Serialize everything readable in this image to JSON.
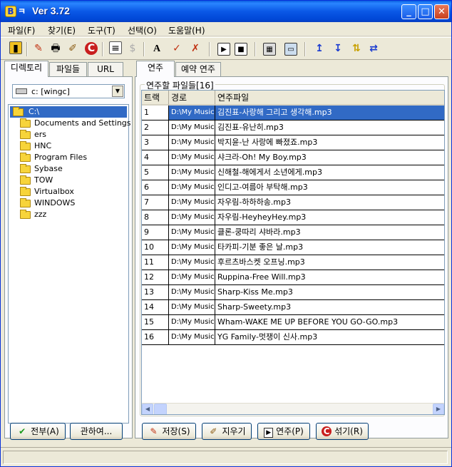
{
  "window": {
    "title": "Ver 3.72",
    "minimize": "_",
    "maximize": "□",
    "close": "✕"
  },
  "menu": [
    "파일(F)",
    "찾기(E)",
    "도구(T)",
    "선택(O)",
    "도움말(H)"
  ],
  "left": {
    "tabs": [
      "디렉토리",
      "파일들",
      "URL"
    ],
    "drive": "c: [wingc]",
    "tree_root": "C:\\",
    "folders": [
      "Documents and Settings",
      "ers",
      "HNC",
      "Program Files",
      "Sybase",
      "TOW",
      "Virtualbox",
      "WINDOWS",
      "zzz"
    ],
    "select_all_button": "전부(A)",
    "about_button": "관하여..."
  },
  "right": {
    "tabs": [
      "연주",
      "예약 연주"
    ],
    "group_title": "연주할 파일들[16]",
    "columns": [
      "트랙",
      "경로",
      "연주파일"
    ],
    "rows": [
      {
        "track": "1",
        "path": "D:\\My Music",
        "file": "김진표-사랑해 그리고 생각해.mp3"
      },
      {
        "track": "2",
        "path": "D:\\My Music",
        "file": "김진표-유난히.mp3"
      },
      {
        "track": "3",
        "path": "D:\\My Music",
        "file": "박지윤-난 사랑에 빠졌죠.mp3"
      },
      {
        "track": "4",
        "path": "D:\\My Music",
        "file": "샤크라-Oh! My Boy.mp3"
      },
      {
        "track": "5",
        "path": "D:\\My Music",
        "file": "신해철-해에게서 소년에게.mp3"
      },
      {
        "track": "6",
        "path": "D:\\My Music",
        "file": "인디고-여름아 부탁해.mp3"
      },
      {
        "track": "7",
        "path": "D:\\My Music",
        "file": "자우림-하하하송.mp3"
      },
      {
        "track": "8",
        "path": "D:\\My Music",
        "file": "자우림-HeyheyHey.mp3"
      },
      {
        "track": "9",
        "path": "D:\\My Music",
        "file": "클론-쿵따리 샤바라.mp3"
      },
      {
        "track": "10",
        "path": "D:\\My Music",
        "file": "타카피-기분 좋은 날.mp3"
      },
      {
        "track": "11",
        "path": "D:\\My Music",
        "file": "후르츠바스켓 오프닝.mp3"
      },
      {
        "track": "12",
        "path": "D:\\My Music",
        "file": "Ruppina-Free Will.mp3"
      },
      {
        "track": "13",
        "path": "D:\\My Music",
        "file": "Sharp-Kiss Me.mp3"
      },
      {
        "track": "14",
        "path": "D:\\My Music",
        "file": "Sharp-Sweety.mp3"
      },
      {
        "track": "15",
        "path": "D:\\My Music",
        "file": "Wham-WAKE ME UP BEFORE YOU GO-GO.mp3"
      },
      {
        "track": "16",
        "path": "D:\\My Music",
        "file": "YG Family-멋쟁이 신사.mp3"
      }
    ],
    "buttons": {
      "save": "저장(S)",
      "delete": "지우기",
      "play": "연주(P)",
      "shuffle": "섞기(R)"
    }
  },
  "colors": {
    "selection": "#316ac5",
    "titlebar": "#0a58e6"
  }
}
